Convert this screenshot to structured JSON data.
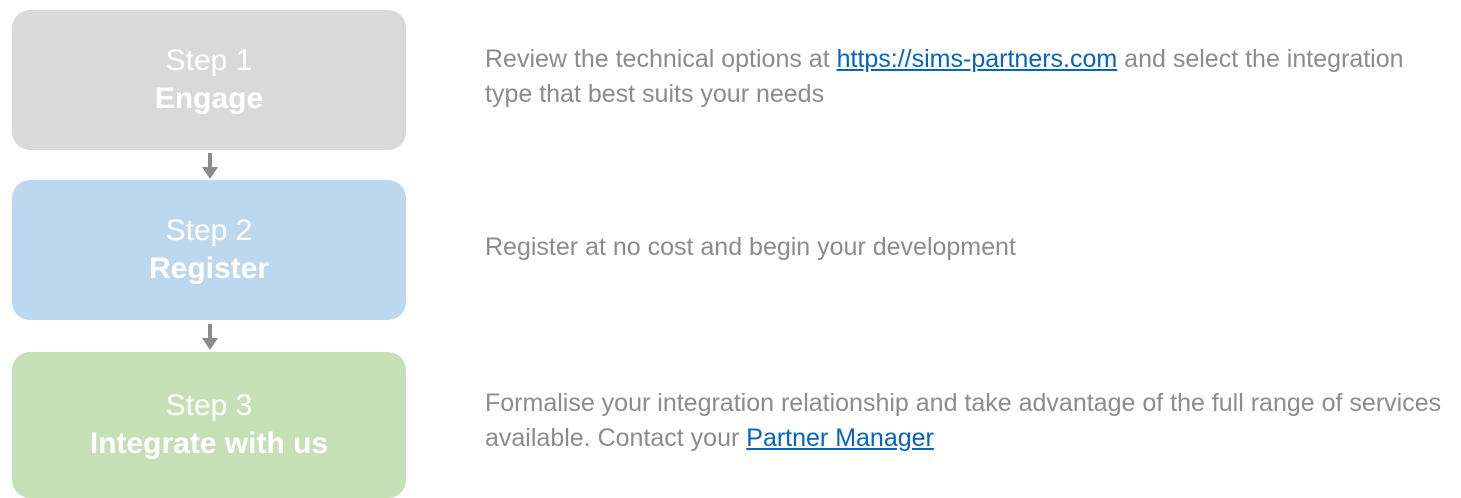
{
  "steps": [
    {
      "number": "Step 1",
      "name": "Engage",
      "color": "#d9d9d9",
      "description": {
        "before": "Review the technical options at ",
        "link": "https://sims-partners.com",
        "after": " and select the integration type that best suits your needs"
      }
    },
    {
      "number": "Step 2",
      "name": "Register",
      "color": "#bdd7ee",
      "description": {
        "text": "Register at no cost and begin your development"
      }
    },
    {
      "number": "Step 3",
      "name": "Integrate with us",
      "color": "#c5e0b4",
      "description": {
        "before": "Formalise your integration relationship and take advantage of the full range of services available. Contact your ",
        "link": "Partner Manager"
      }
    }
  ],
  "colors": {
    "text": "#8c8c8c",
    "link": "#0563c1",
    "arrow": "#8c8c8c"
  },
  "icons": {
    "arrow": "arrow-down-icon"
  }
}
